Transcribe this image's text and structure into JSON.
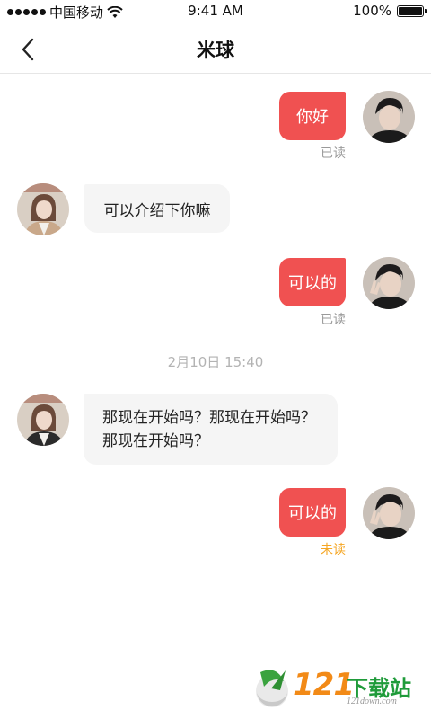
{
  "status_bar": {
    "carrier": "中国移动",
    "time": "9:41 AM",
    "battery": "100%",
    "battery_level": 1.0
  },
  "header": {
    "title": "米球"
  },
  "messages": [
    {
      "direction": "out",
      "text": "你好",
      "status": "已读"
    },
    {
      "direction": "in",
      "text": "可以介绍下你嘛"
    },
    {
      "direction": "out",
      "text": "可以的",
      "status": "已读"
    },
    {
      "timestamp": "2月10日 15:40"
    },
    {
      "direction": "in",
      "text": "那现在开始吗？那现在开始吗？那现在开始吗？"
    },
    {
      "direction": "out",
      "text": "可以的",
      "status": "未读"
    }
  ],
  "colors": {
    "out_bubble": "#f05151",
    "in_bubble": "#f5f5f5",
    "read": "#9a9a9a",
    "unread": "#f5a623",
    "timestamp": "#b3b3b3"
  },
  "icons": {
    "back": "chevron-left-icon",
    "wifi": "wifi-icon",
    "battery": "battery-icon"
  },
  "watermark": {
    "logo": "121",
    "brand": "下载站",
    "url": "121down.com"
  }
}
